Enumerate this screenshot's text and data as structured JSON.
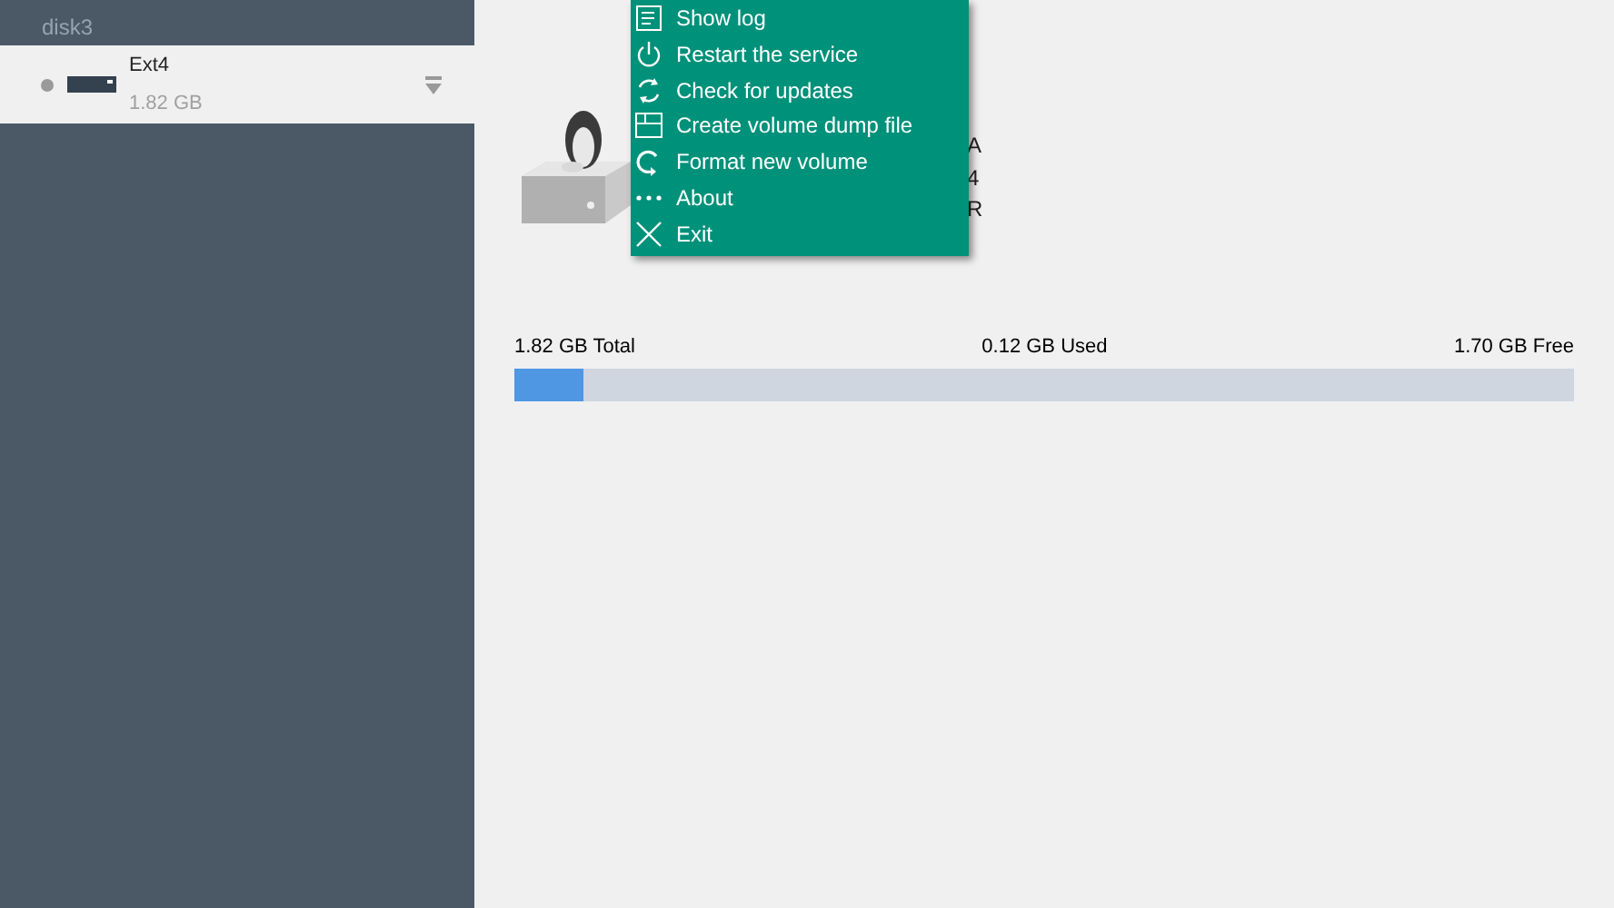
{
  "sidebar": {
    "group_label": "disk3",
    "volumes": [
      {
        "name": "Ext4",
        "size": "1.82 GB",
        "selected": true
      }
    ]
  },
  "details": {
    "lines": [
      "A",
      "4",
      "R"
    ]
  },
  "menu": {
    "items": [
      {
        "label": "Show log",
        "kind": "log"
      },
      {
        "label": "Restart the service",
        "kind": "power"
      },
      {
        "label": "Check for updates",
        "kind": "sync"
      },
      {
        "label": "Create volume dump file",
        "kind": "dump"
      },
      {
        "label": "Format new volume",
        "kind": "format"
      },
      {
        "label": "About",
        "kind": "dots"
      },
      {
        "label": "Exit",
        "kind": "exit"
      }
    ]
  },
  "usage": {
    "total": "1.82 GB Total",
    "used": "0.12 GB Used",
    "free": "1.70 GB Free",
    "level": 0.066
  }
}
